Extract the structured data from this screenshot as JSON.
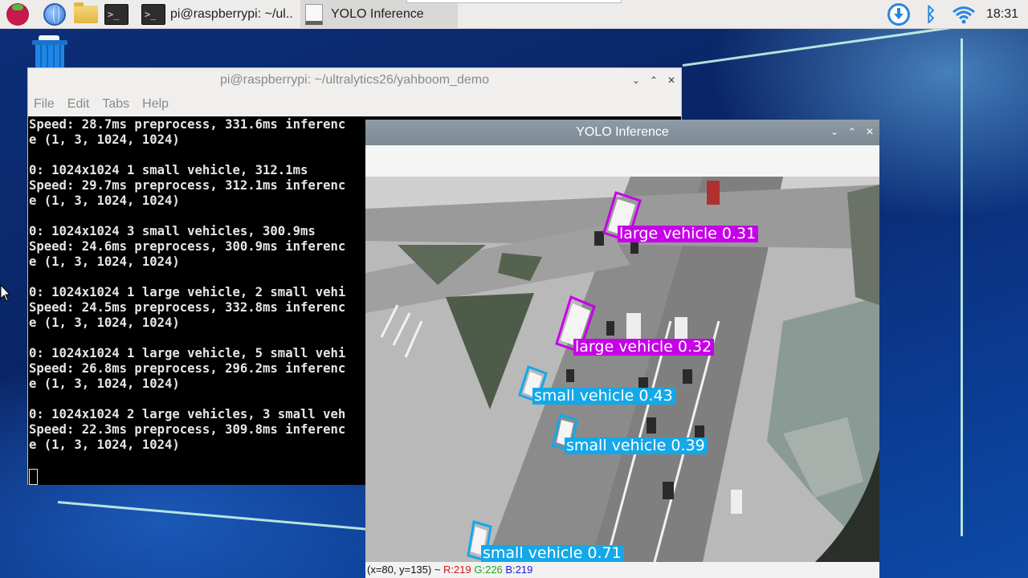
{
  "panel": {
    "taskbar": {
      "terminal_task_label": "pi@raspberrypi: ~/ul..",
      "yolo_task_label": "YOLO Inference"
    },
    "clock": "18:31"
  },
  "terminal": {
    "title": "pi@raspberrypi: ~/ultralytics26/yahboom_demo",
    "menu": [
      "File",
      "Edit",
      "Tabs",
      "Help"
    ],
    "lines": [
      "Speed: 28.7ms preprocess, 331.6ms inferenc",
      "e (1, 3, 1024, 1024)",
      "",
      "0: 1024x1024 1 small vehicle, 312.1ms",
      "Speed: 29.7ms preprocess, 312.1ms inferenc",
      "e (1, 3, 1024, 1024)",
      "",
      "0: 1024x1024 3 small vehicles, 300.9ms",
      "Speed: 24.6ms preprocess, 300.9ms inferenc",
      "e (1, 3, 1024, 1024)",
      "",
      "0: 1024x1024 1 large vehicle, 2 small vehi",
      "Speed: 24.5ms preprocess, 332.8ms inferenc",
      "e (1, 3, 1024, 1024)",
      "",
      "0: 1024x1024 1 large vehicle, 5 small vehi",
      "Speed: 26.8ms preprocess, 296.2ms inferenc",
      "e (1, 3, 1024, 1024)",
      "",
      "0: 1024x1024 2 large vehicles, 3 small veh",
      "Speed: 22.3ms preprocess, 309.8ms inferenc",
      "e (1, 3, 1024, 1024)"
    ]
  },
  "yolo": {
    "title": "YOLO Inference",
    "detections": [
      {
        "label": "large vehicle 0.31",
        "class": "large"
      },
      {
        "label": "large vehicle 0.32",
        "class": "large"
      },
      {
        "label": "small vehicle 0.43",
        "class": "small"
      },
      {
        "label": "small vehicle 0.39",
        "class": "small"
      },
      {
        "label": "small vehicle 0.71",
        "class": "small"
      }
    ],
    "colors": {
      "large": "#c600e8",
      "small": "#14a8e8"
    },
    "status": {
      "coords": "(x=80, y=135) ~",
      "r": "R:219",
      "g": "G:226",
      "b": "B:219"
    }
  }
}
